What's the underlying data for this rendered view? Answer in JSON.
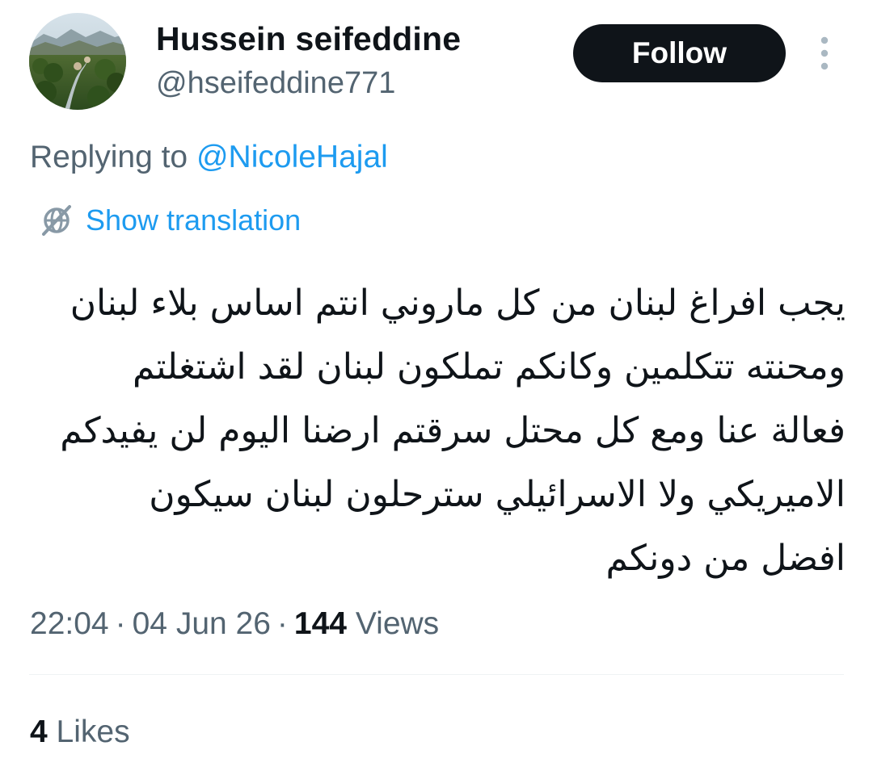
{
  "colors": {
    "accent": "#1d9bf0",
    "text_primary": "#0f1419",
    "text_secondary": "#536471",
    "follow_bg": "#0f1419",
    "follow_text": "#ffffff",
    "divider": "#eff3f4"
  },
  "author": {
    "display_name": "Hussein seifeddine",
    "handle": "@hseifeddine771",
    "avatar_icon": "landscape-avatar"
  },
  "header": {
    "follow_label": "Follow",
    "more_icon": "vertical-dots-icon"
  },
  "reply": {
    "prefix": "Replying to",
    "mention": "@NicoleHajal"
  },
  "translation": {
    "icon": "globe-slash-icon",
    "label": "Show translation"
  },
  "tweet": {
    "lines": [
      "يجب افراغ لبنان من كل ماروني انتم اساس بلاء لبنان",
      "ومحنته تتكلمين وكانكم تملكون لبنان لقد اشتغلتم",
      "فعالة عنا ومع كل محتل سرقتم ارضنا اليوم لن يفيدكم",
      "الاميريكي ولا الاسرائيلي سترحلون لبنان سيكون",
      "افضل من دونكم"
    ]
  },
  "meta": {
    "time": "22:04",
    "date": "04 Jun 26",
    "views_count": "144",
    "views_label": "Views"
  },
  "engagement": {
    "likes_count": "4",
    "likes_label": "Likes"
  }
}
